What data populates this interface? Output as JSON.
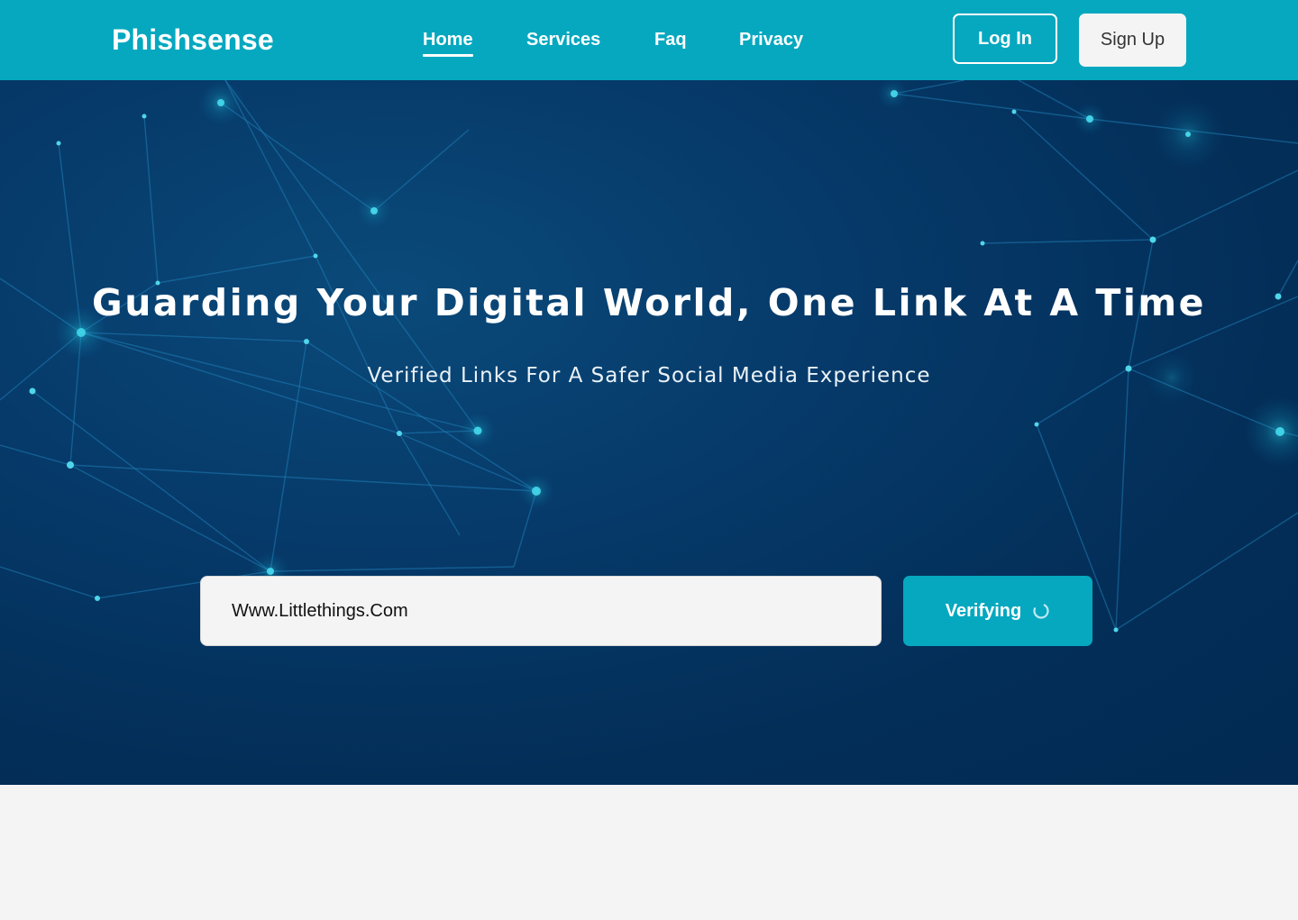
{
  "header": {
    "logo": "Phishsense",
    "nav": [
      "Home",
      "Services",
      "Faq",
      "Privacy"
    ],
    "active_nav": "Home",
    "login_label": "Log In",
    "signup_label": "Sign Up"
  },
  "hero": {
    "title": "Guarding Your Digital World, One Link At A Time",
    "subtitle": "Verified Links For A Safer Social Media Experience",
    "url_value": "Www.Littlethings.Com",
    "verify_label": "Verifying",
    "verify_icon": "spinner-icon"
  },
  "colors": {
    "accent": "#05a8bf",
    "hero_bg": "#032e58",
    "page_bg": "#f4f4f4"
  }
}
